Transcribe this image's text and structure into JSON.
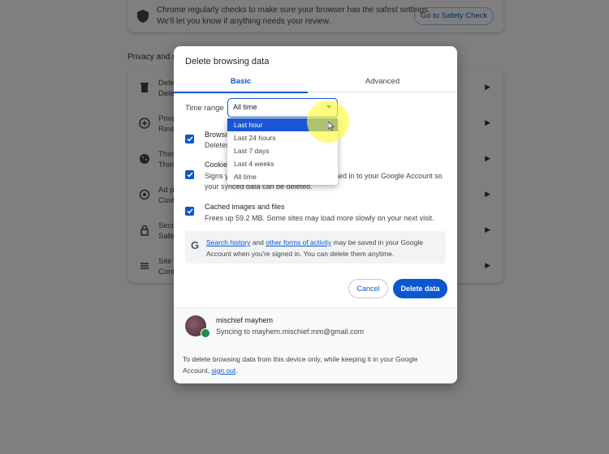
{
  "background": {
    "safety": {
      "line1": "Chrome regularly checks to make sure your browser has the safest settings.",
      "line2": "We'll let you know if anything needs your review.",
      "button": "Go to Safety Check"
    },
    "section_title": "Privacy and s",
    "rows": [
      {
        "l1": "Dele",
        "l2": "Dele"
      },
      {
        "l1": "Priva",
        "l2": "Revie"
      },
      {
        "l1": "Third",
        "l2": "Third"
      },
      {
        "l1": "Ad p",
        "l2": "Custo"
      },
      {
        "l1": "Secu",
        "l2": "Safe"
      },
      {
        "l1": "Site s",
        "l2": "Contr"
      }
    ]
  },
  "dialog": {
    "title": "Delete browsing data",
    "tabs": {
      "basic": "Basic",
      "advanced": "Advanced"
    },
    "time_range": {
      "label": "Time range",
      "value": "All time"
    },
    "options": [
      {
        "title": "Browsin",
        "desc": "Deletes"
      },
      {
        "title": "Cookie",
        "desc1": "Signs y",
        "desc1_tail": "ned in to your Google Account so",
        "desc2": "your synced data can be deleted."
      },
      {
        "title": "Cached images and files",
        "desc": "Frees up 59.2 MB. Some sites may load more slowly on your next visit."
      }
    ],
    "info": {
      "link1": "Search history",
      "mid": " and ",
      "link2": "other forms of activity",
      "tail": " may be saved in your Google",
      "line2": "Account when you're signed in. You can delete them anytime."
    },
    "buttons": {
      "cancel": "Cancel",
      "delete": "Delete data"
    },
    "account": {
      "name": "mischief mayhem",
      "sync": "Syncing to mayhem.mischief.mm@gmail.com"
    },
    "footer": {
      "line1": "To delete browsing data from this device only, while keeping it in your Google",
      "line2_pre": "Account, ",
      "link": "sign out",
      "line2_post": "."
    }
  },
  "dropdown": {
    "items": [
      "Last hour",
      "Last 24 hours",
      "Last 7 days",
      "Last 4 weeks",
      "All time"
    ],
    "selected_index": 0
  },
  "colors": {
    "accent": "#0b57d0",
    "selected": "#1a56d6",
    "sync_green": "#1e8e3e"
  }
}
